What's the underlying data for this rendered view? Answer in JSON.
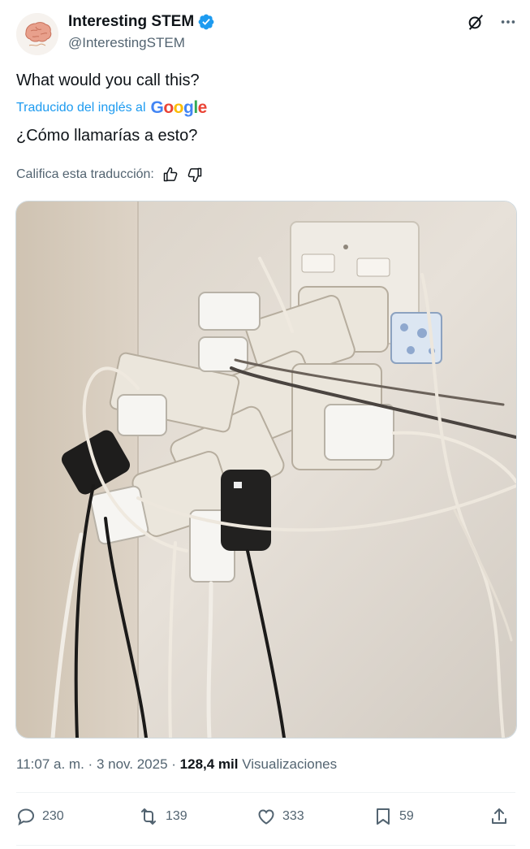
{
  "account": {
    "name": "Interesting STEM",
    "handle": "@InterestingSTEM",
    "verified_color": "#1d9bf0"
  },
  "tweet": {
    "original_text": "What would you call this?",
    "translated_by": "Traducido del inglés al",
    "translation_engine": "Google",
    "translated_text": "¿Cómo llamarías a esto?",
    "rate_label": "Califica esta traducción:"
  },
  "meta": {
    "time": "11:07 a. m.",
    "dot1": "·",
    "date": "3 nov. 2025",
    "dot2": "·",
    "views_count": "128,4 mil",
    "views_label": "Visualizaciones"
  },
  "actions": {
    "replies": "230",
    "reposts": "139",
    "likes": "333",
    "bookmarks": "59"
  },
  "icons": [
    "verified-icon",
    "grok-icon",
    "more-icon",
    "thumbs-up-icon",
    "thumbs-down-icon",
    "reply-icon",
    "repost-icon",
    "like-icon",
    "bookmark-icon",
    "share-icon"
  ]
}
